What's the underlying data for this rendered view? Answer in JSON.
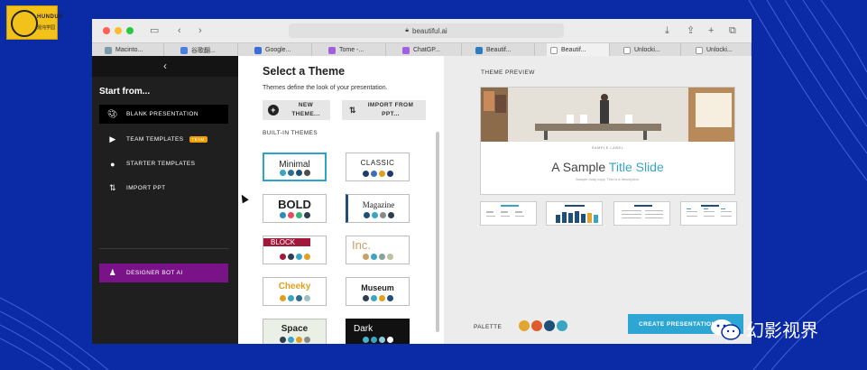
{
  "brand": {
    "logo_text": "HUNDUN",
    "logo_sub": "混沌学园",
    "watermark": "幻影视界"
  },
  "browser": {
    "url": "beautiful.ai",
    "tabs": [
      {
        "label": "Macinto...",
        "color": "#7a9aa8"
      },
      {
        "label": "谷歌翻...",
        "color": "#4a7fe0"
      },
      {
        "label": "Google...",
        "color": "#3a6fd8"
      },
      {
        "label": "Tome -...",
        "color": "#a060e0"
      },
      {
        "label": "ChatGP...",
        "color": "#a060e0"
      },
      {
        "label": "Beautif...",
        "color": "#2d7cc1"
      },
      {
        "label": "Beautif...",
        "color": "#ffffff"
      },
      {
        "label": "Unlocki...",
        "color": "#ffffff"
      },
      {
        "label": "Unlocki...",
        "color": "#ffffff"
      }
    ]
  },
  "sidebar": {
    "collapse": "‹",
    "start_from": "Start from...",
    "items": [
      {
        "label": "BLANK PRESENTATION",
        "icon": "palette-icon"
      },
      {
        "label": "TEAM TEMPLATES",
        "icon": "templates-icon",
        "badge": "TEAM"
      },
      {
        "label": "STARTER TEMPLATES",
        "icon": "bulb-icon"
      },
      {
        "label": "IMPORT PPT",
        "icon": "import-icon"
      }
    ],
    "designer_bot": "DESIGNER BOT AI"
  },
  "themes": {
    "title": "Select a Theme",
    "description": "Themes define the look of your presentation.",
    "new_theme": "NEW THEME...",
    "import_ppt": "IMPORT FROM PPT...",
    "built_in": "BUILT-IN THEMES",
    "cards": [
      {
        "name": "Minimal",
        "colors": [
          "#3aa5c3",
          "#2c6e8f",
          "#1f4e79",
          "#4d4d4d"
        ]
      },
      {
        "name": "CLASSIC",
        "colors": [
          "#1f3a6e",
          "#3b6fb6",
          "#e0a020",
          "#1f3a6e"
        ]
      },
      {
        "name": "BOLD",
        "colors": [
          "#2e8bc0",
          "#e84a5f",
          "#3bb273",
          "#2c3e50"
        ]
      },
      {
        "name": "Magazine",
        "colors": [
          "#1f4e79",
          "#3aa5c3",
          "#8a8a8a",
          "#2c3e50"
        ]
      },
      {
        "name": "BLOCK",
        "colors": [
          "#a0183a",
          "#2c3e50",
          "#3aa5c3",
          "#e0a020"
        ]
      },
      {
        "name": "Inc.",
        "colors": [
          "#c9a06a",
          "#3aa5c3",
          "#8aa09a",
          "#c0c0a0"
        ]
      },
      {
        "name": "Cheeky",
        "colors": [
          "#e0a020",
          "#3aa5c3",
          "#2c6e8f",
          "#a0c0c0"
        ]
      },
      {
        "name": "Museum",
        "colors": [
          "#2c3e50",
          "#3aa5c3",
          "#e0a020",
          "#1f4e79"
        ]
      },
      {
        "name": "Space",
        "colors": [
          "#2c3e50",
          "#3aa5c3",
          "#e0a020",
          "#8a8a8a"
        ]
      },
      {
        "name": "Dark",
        "colors": [
          "#4ab3c8",
          "#3aa5c3",
          "#8acad8",
          "#ffffff"
        ]
      }
    ]
  },
  "preview": {
    "label": "THEME PREVIEW",
    "sample_label": "SAMPLE LABEL",
    "title_a": "A Sample ",
    "title_b": "Title Slide",
    "body": "Sample body copy. This is a description.",
    "palette_label": "PALETTE",
    "palette": [
      "#e3a532",
      "#e05a2b",
      "#1f4e79",
      "#3aa5c3"
    ],
    "create": "CREATE PRESENTATION"
  }
}
